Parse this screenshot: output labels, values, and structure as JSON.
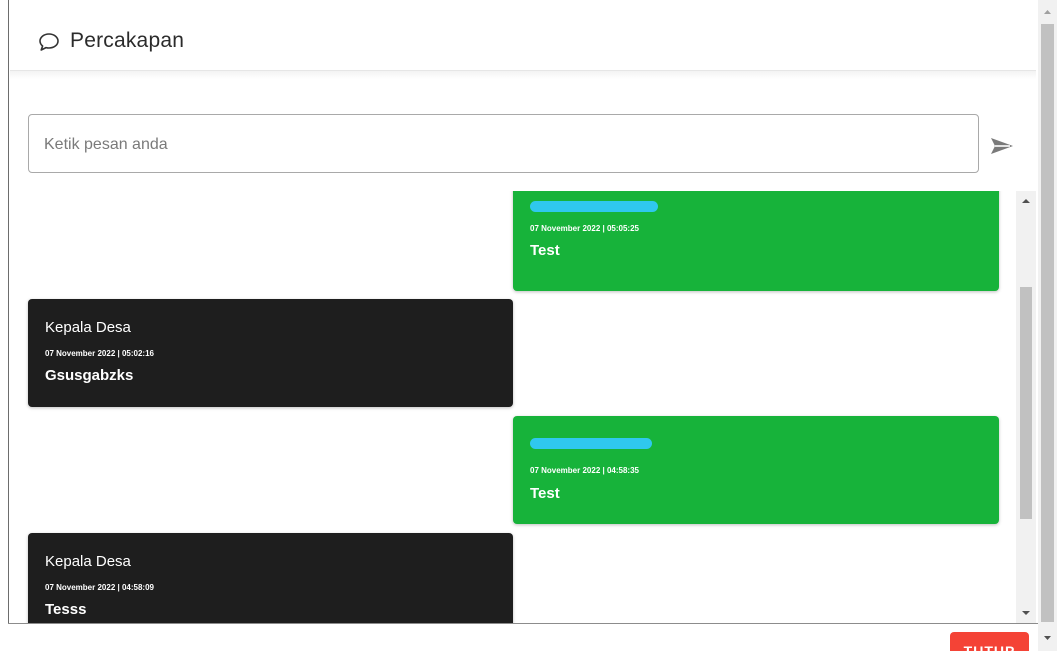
{
  "header": {
    "icon": "chat-bubble-icon",
    "title": "Percakapan"
  },
  "composer": {
    "placeholder": "Ketik pesan anda",
    "send_icon": "send-icon"
  },
  "messages": [
    {
      "direction": "out",
      "sender": "",
      "sender_redacted": true,
      "timestamp": "07 November 2022 | 05:05:25",
      "text": "Test"
    },
    {
      "direction": "in",
      "sender": "Kepala Desa",
      "sender_redacted": false,
      "timestamp": "07 November 2022 | 05:02:16",
      "text": "Gsusgabzks"
    },
    {
      "direction": "out",
      "sender": "",
      "sender_redacted": true,
      "timestamp": "07 November 2022 | 04:58:35",
      "text": "Test"
    },
    {
      "direction": "in",
      "sender": "Kepala Desa",
      "sender_redacted": false,
      "timestamp": "07 November 2022 | 04:58:09",
      "text": "Tesss"
    }
  ],
  "footer": {
    "close_label": "TUTUP"
  },
  "colors": {
    "outgoing": "#17b33a",
    "incoming": "#1e1e1e",
    "close_button": "#f44336",
    "redaction": "#2fc8ee"
  }
}
